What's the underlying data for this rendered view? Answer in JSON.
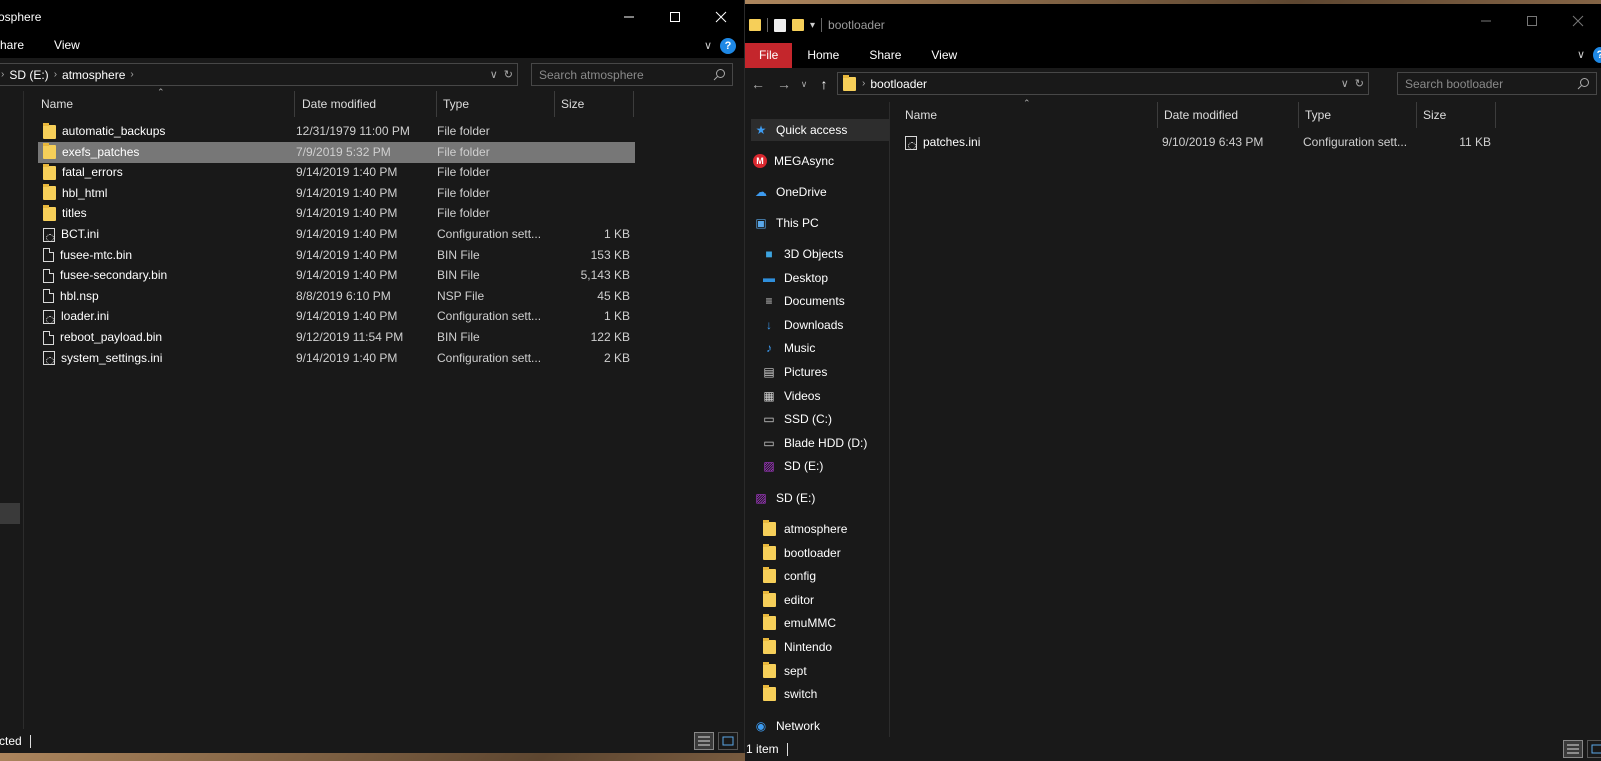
{
  "left_window": {
    "title": "osphere",
    "ribbon_tabs": [
      "hare",
      "View"
    ],
    "address": {
      "root": "SD (E:)",
      "folder": "atmosphere"
    },
    "search_placeholder": "Search atmosphere",
    "columns": {
      "name": "Name",
      "date": "Date modified",
      "type": "Type",
      "size": "Size"
    },
    "rows": [
      {
        "name": "automatic_backups",
        "date": "12/31/1979 11:00 PM",
        "type": "File folder",
        "size": "",
        "icon": "folder-icon"
      },
      {
        "name": "exefs_patches",
        "date": "7/9/2019 5:32 PM",
        "type": "File folder",
        "size": "",
        "icon": "folder-icon",
        "selected": true
      },
      {
        "name": "fatal_errors",
        "date": "9/14/2019 1:40 PM",
        "type": "File folder",
        "size": "",
        "icon": "folder-icon"
      },
      {
        "name": "hbl_html",
        "date": "9/14/2019 1:40 PM",
        "type": "File folder",
        "size": "",
        "icon": "folder-icon"
      },
      {
        "name": "titles",
        "date": "9/14/2019 1:40 PM",
        "type": "File folder",
        "size": "",
        "icon": "folder-icon"
      },
      {
        "name": "BCT.ini",
        "date": "9/14/2019 1:40 PM",
        "type": "Configuration sett...",
        "size": "1 KB",
        "icon": "config-file-icon"
      },
      {
        "name": "fusee-mtc.bin",
        "date": "9/14/2019 1:40 PM",
        "type": "BIN File",
        "size": "153 KB",
        "icon": "file-icon"
      },
      {
        "name": "fusee-secondary.bin",
        "date": "9/14/2019 1:40 PM",
        "type": "BIN File",
        "size": "5,143 KB",
        "icon": "file-icon"
      },
      {
        "name": "hbl.nsp",
        "date": "8/8/2019 6:10 PM",
        "type": "NSP File",
        "size": "45 KB",
        "icon": "file-icon"
      },
      {
        "name": "loader.ini",
        "date": "9/14/2019 1:40 PM",
        "type": "Configuration sett...",
        "size": "1 KB",
        "icon": "config-file-icon"
      },
      {
        "name": "reboot_payload.bin",
        "date": "9/12/2019 11:54 PM",
        "type": "BIN File",
        "size": "122 KB",
        "icon": "file-icon"
      },
      {
        "name": "system_settings.ini",
        "date": "9/14/2019 1:40 PM",
        "type": "Configuration sett...",
        "size": "2 KB",
        "icon": "config-file-icon"
      }
    ],
    "status": "cted"
  },
  "right_window": {
    "title": "bootloader",
    "ribbon_tabs": [
      "File",
      "Home",
      "Share",
      "View"
    ],
    "address": {
      "folder": "bootloader"
    },
    "search_placeholder": "Search bootloader",
    "columns": {
      "name": "Name",
      "date": "Date modified",
      "type": "Type",
      "size": "Size"
    },
    "rows": [
      {
        "name": "patches.ini",
        "date": "9/10/2019 6:43 PM",
        "type": "Configuration sett...",
        "size": "11 KB",
        "icon": "config-file-icon"
      }
    ],
    "nav": [
      {
        "label": "Quick access",
        "icon": "star-icon",
        "color": "#3d9bf0",
        "indent": 0,
        "hover": true
      },
      {
        "label": "MEGAsync",
        "icon": "mega-icon",
        "color": "#d9272e",
        "indent": 0
      },
      {
        "label": "OneDrive",
        "icon": "cloud-icon",
        "color": "#3d9bf0",
        "indent": 0
      },
      {
        "label": "This PC",
        "icon": "computer-icon",
        "color": "#5aa7e8",
        "indent": 0
      },
      {
        "label": "3D Objects",
        "icon": "cube-icon",
        "color": "#3da4e0",
        "indent": 1
      },
      {
        "label": "Desktop",
        "icon": "desktop-icon",
        "color": "#2f8fdc",
        "indent": 1
      },
      {
        "label": "Documents",
        "icon": "document-icon",
        "color": "#cfcfcf",
        "indent": 1
      },
      {
        "label": "Downloads",
        "icon": "download-icon",
        "color": "#3d9bf0",
        "indent": 1
      },
      {
        "label": "Music",
        "icon": "music-icon",
        "color": "#3d9bf0",
        "indent": 1
      },
      {
        "label": "Pictures",
        "icon": "picture-icon",
        "color": "#cfcfcf",
        "indent": 1
      },
      {
        "label": "Videos",
        "icon": "video-icon",
        "color": "#cfcfcf",
        "indent": 1
      },
      {
        "label": "SSD (C:)",
        "icon": "drive-icon",
        "color": "#cfcfcf",
        "indent": 1
      },
      {
        "label": "Blade HDD (D:)",
        "icon": "drive-icon",
        "color": "#cfcfcf",
        "indent": 1
      },
      {
        "label": "SD (E:)",
        "icon": "sd-card-icon",
        "color": "#b03bd6",
        "indent": 1
      },
      {
        "label": "SD (E:)",
        "icon": "sd-card-icon",
        "color": "#b03bd6",
        "indent": 0,
        "gap": true
      },
      {
        "label": "atmosphere",
        "icon": "folder-icon",
        "color": "#f6cf59",
        "indent": 1
      },
      {
        "label": "bootloader",
        "icon": "folder-icon",
        "color": "#f6cf59",
        "indent": 1
      },
      {
        "label": "config",
        "icon": "folder-icon",
        "color": "#f6cf59",
        "indent": 1
      },
      {
        "label": "editor",
        "icon": "folder-icon",
        "color": "#f6cf59",
        "indent": 1
      },
      {
        "label": "emuMMC",
        "icon": "folder-icon",
        "color": "#f6cf59",
        "indent": 1
      },
      {
        "label": "Nintendo",
        "icon": "folder-icon",
        "color": "#f6cf59",
        "indent": 1
      },
      {
        "label": "sept",
        "icon": "folder-icon",
        "color": "#f6cf59",
        "indent": 1
      },
      {
        "label": "switch",
        "icon": "folder-icon",
        "color": "#f6cf59",
        "indent": 1
      },
      {
        "label": "Network",
        "icon": "network-icon",
        "color": "#3d9bf0",
        "indent": 0,
        "gap": true
      }
    ],
    "status": "1 item"
  },
  "colors": {
    "file_tab": "#c4262c",
    "selection": "#777777",
    "folder": "#f6cf59",
    "window_bg": "#191919",
    "titlebar": "#000000"
  }
}
